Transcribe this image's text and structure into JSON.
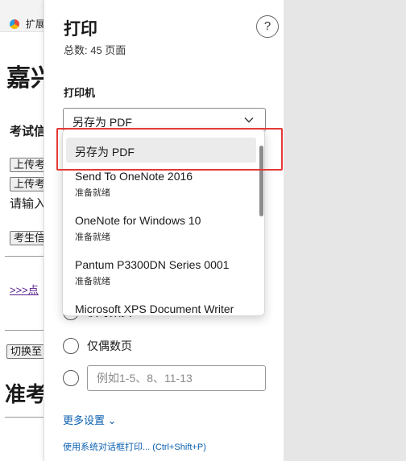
{
  "background_page": {
    "tab_label": "扩展",
    "title": "嘉兴",
    "subhead": "考试信",
    "upload_button_1": "上传考",
    "upload_button_2": "上传考",
    "prompt_text": "请输入",
    "candidate_button": "考生信",
    "link_text": ">>>点",
    "switch_button": "切换至",
    "ticket_heading": "准考"
  },
  "print_dialog": {
    "title": "打印",
    "total_pages": "总数: 45 页面",
    "help_symbol": "?",
    "printer_label": "打印机",
    "printer_selected": "另存为 PDF",
    "printer_options": [
      {
        "name": "另存为 PDF",
        "status": ""
      },
      {
        "name": "Send To OneNote 2016",
        "status": "准备就绪"
      },
      {
        "name": "OneNote for Windows 10",
        "status": "准备就绪"
      },
      {
        "name": "Pantum P3300DN Series 0001",
        "status": "准备就绪"
      },
      {
        "name": "Microsoft XPS Document Writer",
        "status": ""
      }
    ],
    "page_option_odd": "仅奇数页",
    "page_option_even": "仅偶数页",
    "custom_range_placeholder": "例如1-5、8、11-13",
    "more_settings": "更多设置 ⌄",
    "system_dialog_link": "使用系统对话框打印... (Ctrl+Shift+P)"
  },
  "colors": {
    "accent_link": "#0b5fb0",
    "highlight_border": "#e53935"
  }
}
